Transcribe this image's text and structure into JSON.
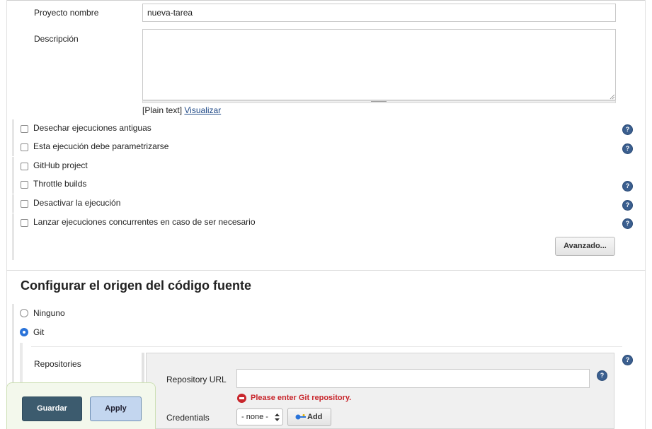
{
  "project": {
    "name_label": "Proyecto nombre",
    "name_value": "nueva-tarea",
    "description_label": "Descripción",
    "description_value": "",
    "format_plain": "[Plain text]",
    "format_preview_link": "Visualizar"
  },
  "options": [
    {
      "label": "Desechar ejecuciones antiguas",
      "checked": false,
      "help": true
    },
    {
      "label": "Esta ejecución debe parametrizarse",
      "checked": false,
      "help": true
    },
    {
      "label": "GitHub project",
      "checked": false,
      "help": false
    },
    {
      "label": "Throttle builds",
      "checked": false,
      "help": true
    },
    {
      "label": "Desactivar la ejecución",
      "checked": false,
      "help": true
    },
    {
      "label": "Lanzar ejecuciones concurrentes en caso de ser necesario",
      "checked": false,
      "help": true
    }
  ],
  "advanced_button": "Avanzado...",
  "scm": {
    "title": "Configurar el origen del código fuente",
    "options": [
      {
        "label": "Ninguno",
        "selected": false
      },
      {
        "label": "Git",
        "selected": true
      }
    ],
    "repositories_label": "Repositories",
    "repository_url_label": "Repository URL",
    "repository_url_value": "",
    "error_message": "Please enter Git repository.",
    "credentials_label": "Credentials",
    "credentials_selected": "- none -",
    "add_button": "Add"
  },
  "footer": {
    "save_button": "Guardar",
    "apply_button": "Apply"
  },
  "colors": {
    "primary_button": "#3c5b6e",
    "apply_button": "#c3d6ef",
    "error": "#c8262c",
    "link": "#204a87",
    "help_icon": "#3b5f8f",
    "radio_selected": "#2a73d9"
  },
  "icons": {
    "help": "help-icon",
    "error": "error-icon",
    "key": "key-icon",
    "dropdown": "updown-arrow-icon"
  }
}
